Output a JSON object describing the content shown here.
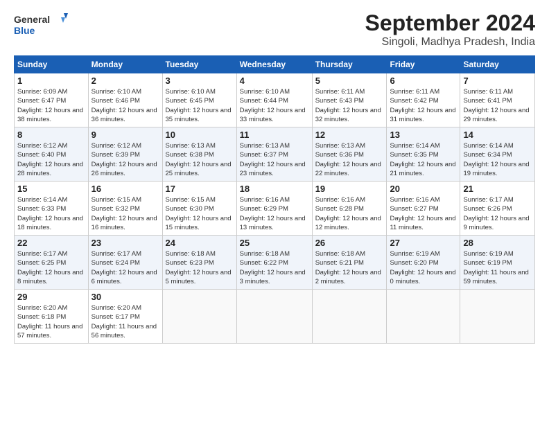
{
  "header": {
    "logo_line1": "General",
    "logo_line2": "Blue",
    "month_title": "September 2024",
    "subtitle": "Singoli, Madhya Pradesh, India"
  },
  "days_of_week": [
    "Sunday",
    "Monday",
    "Tuesday",
    "Wednesday",
    "Thursday",
    "Friday",
    "Saturday"
  ],
  "weeks": [
    [
      {
        "day": 1,
        "sunrise": "6:09 AM",
        "sunset": "6:47 PM",
        "daylight": "12 hours and 38 minutes."
      },
      {
        "day": 2,
        "sunrise": "6:10 AM",
        "sunset": "6:46 PM",
        "daylight": "12 hours and 36 minutes."
      },
      {
        "day": 3,
        "sunrise": "6:10 AM",
        "sunset": "6:45 PM",
        "daylight": "12 hours and 35 minutes."
      },
      {
        "day": 4,
        "sunrise": "6:10 AM",
        "sunset": "6:44 PM",
        "daylight": "12 hours and 33 minutes."
      },
      {
        "day": 5,
        "sunrise": "6:11 AM",
        "sunset": "6:43 PM",
        "daylight": "12 hours and 32 minutes."
      },
      {
        "day": 6,
        "sunrise": "6:11 AM",
        "sunset": "6:42 PM",
        "daylight": "12 hours and 31 minutes."
      },
      {
        "day": 7,
        "sunrise": "6:11 AM",
        "sunset": "6:41 PM",
        "daylight": "12 hours and 29 minutes."
      }
    ],
    [
      {
        "day": 8,
        "sunrise": "6:12 AM",
        "sunset": "6:40 PM",
        "daylight": "12 hours and 28 minutes."
      },
      {
        "day": 9,
        "sunrise": "6:12 AM",
        "sunset": "6:39 PM",
        "daylight": "12 hours and 26 minutes."
      },
      {
        "day": 10,
        "sunrise": "6:13 AM",
        "sunset": "6:38 PM",
        "daylight": "12 hours and 25 minutes."
      },
      {
        "day": 11,
        "sunrise": "6:13 AM",
        "sunset": "6:37 PM",
        "daylight": "12 hours and 23 minutes."
      },
      {
        "day": 12,
        "sunrise": "6:13 AM",
        "sunset": "6:36 PM",
        "daylight": "12 hours and 22 minutes."
      },
      {
        "day": 13,
        "sunrise": "6:14 AM",
        "sunset": "6:35 PM",
        "daylight": "12 hours and 21 minutes."
      },
      {
        "day": 14,
        "sunrise": "6:14 AM",
        "sunset": "6:34 PM",
        "daylight": "12 hours and 19 minutes."
      }
    ],
    [
      {
        "day": 15,
        "sunrise": "6:14 AM",
        "sunset": "6:33 PM",
        "daylight": "12 hours and 18 minutes."
      },
      {
        "day": 16,
        "sunrise": "6:15 AM",
        "sunset": "6:32 PM",
        "daylight": "12 hours and 16 minutes."
      },
      {
        "day": 17,
        "sunrise": "6:15 AM",
        "sunset": "6:30 PM",
        "daylight": "12 hours and 15 minutes."
      },
      {
        "day": 18,
        "sunrise": "6:16 AM",
        "sunset": "6:29 PM",
        "daylight": "12 hours and 13 minutes."
      },
      {
        "day": 19,
        "sunrise": "6:16 AM",
        "sunset": "6:28 PM",
        "daylight": "12 hours and 12 minutes."
      },
      {
        "day": 20,
        "sunrise": "6:16 AM",
        "sunset": "6:27 PM",
        "daylight": "12 hours and 11 minutes."
      },
      {
        "day": 21,
        "sunrise": "6:17 AM",
        "sunset": "6:26 PM",
        "daylight": "12 hours and 9 minutes."
      }
    ],
    [
      {
        "day": 22,
        "sunrise": "6:17 AM",
        "sunset": "6:25 PM",
        "daylight": "12 hours and 8 minutes."
      },
      {
        "day": 23,
        "sunrise": "6:17 AM",
        "sunset": "6:24 PM",
        "daylight": "12 hours and 6 minutes."
      },
      {
        "day": 24,
        "sunrise": "6:18 AM",
        "sunset": "6:23 PM",
        "daylight": "12 hours and 5 minutes."
      },
      {
        "day": 25,
        "sunrise": "6:18 AM",
        "sunset": "6:22 PM",
        "daylight": "12 hours and 3 minutes."
      },
      {
        "day": 26,
        "sunrise": "6:18 AM",
        "sunset": "6:21 PM",
        "daylight": "12 hours and 2 minutes."
      },
      {
        "day": 27,
        "sunrise": "6:19 AM",
        "sunset": "6:20 PM",
        "daylight": "12 hours and 0 minutes."
      },
      {
        "day": 28,
        "sunrise": "6:19 AM",
        "sunset": "6:19 PM",
        "daylight": "11 hours and 59 minutes."
      }
    ],
    [
      {
        "day": 29,
        "sunrise": "6:20 AM",
        "sunset": "6:18 PM",
        "daylight": "11 hours and 57 minutes."
      },
      {
        "day": 30,
        "sunrise": "6:20 AM",
        "sunset": "6:17 PM",
        "daylight": "11 hours and 56 minutes."
      },
      null,
      null,
      null,
      null,
      null
    ]
  ]
}
